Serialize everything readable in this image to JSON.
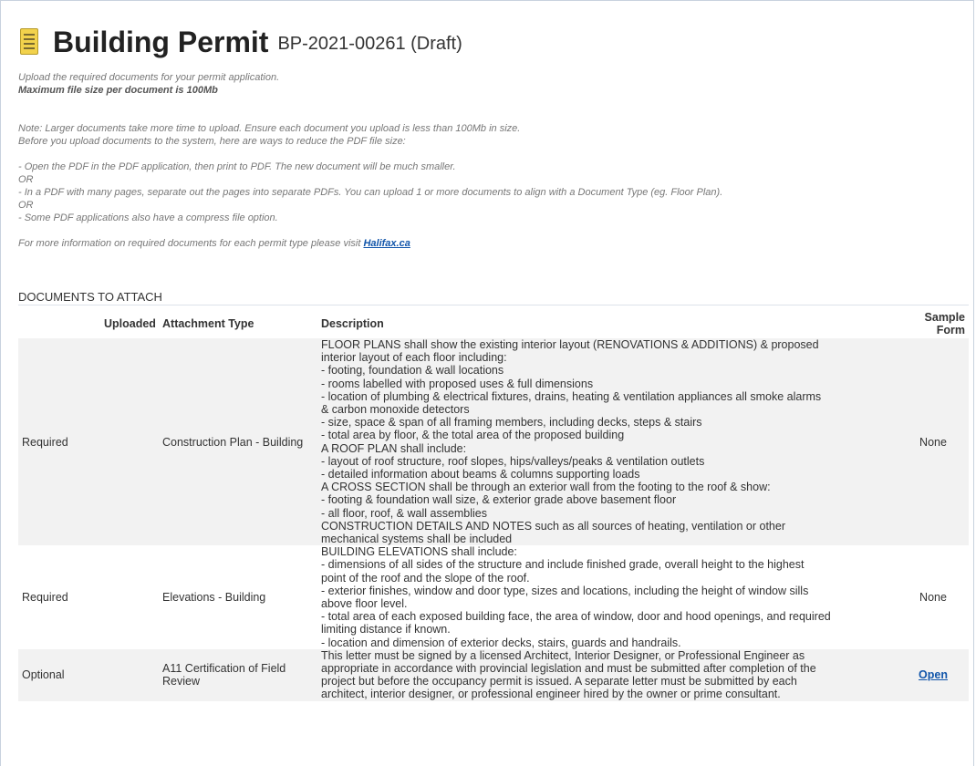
{
  "header": {
    "title": "Building Permit",
    "permit_id": "BP-2021-00261 (Draft)",
    "icon": "document-icon"
  },
  "intro": {
    "line1": "Upload the required documents for your permit application.",
    "line2": "Maximum file size per document is 100Mb",
    "note1": "Note: Larger documents take more time to upload. Ensure each document you upload is less than 100Mb in size.",
    "note2": "Before you upload documents to the system, here are ways to reduce the PDF file size:",
    "tip1": "- Open the PDF in the PDF application, then print to PDF. The new document will be much smaller.",
    "or1": "OR",
    "tip2": "- In a PDF with many pages, separate out the pages into separate PDFs. You can upload 1 or more documents to align with a Document Type (eg. Floor Plan).",
    "or2": "OR",
    "tip3": "- Some PDF applications also have a compress file option.",
    "more_info": "For more information on required documents for each permit type please visit",
    "link_text": "Halifax.ca"
  },
  "documents": {
    "section_title": "DOCUMENTS TO ATTACH",
    "headers": {
      "status": "",
      "uploaded": "Uploaded",
      "attachment_type": "Attachment Type",
      "description": "Description",
      "sample_form": "Sample Form"
    },
    "rows": [
      {
        "status": "Required",
        "uploaded": "",
        "attachment_type": "Construction Plan - Building",
        "description": [
          "FLOOR PLANS shall show the existing interior layout (RENOVATIONS & ADDITIONS) & proposed",
          "interior layout of each floor including:",
          "- footing, foundation & wall locations",
          "- rooms labelled with proposed uses & full dimensions",
          "- location of plumbing & electrical fixtures, drains, heating & ventilation appliances all smoke alarms",
          "& carbon monoxide detectors",
          "- size, space & span of all framing members, including decks, steps & stairs",
          "- total area by floor, & the total area of the proposed building",
          "A ROOF PLAN shall include:",
          "- layout of roof structure, roof slopes, hips/valleys/peaks & ventilation outlets",
          "- detailed information about beams & columns supporting loads",
          "A CROSS SECTION shall be through an exterior wall from the footing to the roof & show:",
          "- footing & foundation wall size, & exterior grade above basement floor",
          "- all floor, roof, & wall assemblies",
          "CONSTRUCTION DETAILS AND NOTES such as all sources of heating, ventilation or other",
          "mechanical systems shall be included"
        ],
        "sample_form": "None"
      },
      {
        "status": "Required",
        "uploaded": "",
        "attachment_type": "Elevations - Building",
        "description": [
          "BUILDING ELEVATIONS shall include:",
          "- dimensions of all sides of the structure and include finished grade, overall height to the highest",
          "point of the roof and the slope of the roof.",
          "- exterior finishes, window and door type, sizes and locations, including the height of window sills",
          "above floor level.",
          "- total area of each exposed building face, the area of window, door and hood openings, and required",
          "limiting distance if known.",
          "- location and dimension of exterior decks, stairs, guards and handrails."
        ],
        "sample_form": "None"
      },
      {
        "status": "Optional",
        "uploaded": "",
        "attachment_type": "A11 Certification of Field Review",
        "description": [
          "This letter must be signed by a licensed Architect, Interior Designer, or Professional Engineer as",
          "appropriate in accordance with provincial legislation and must be submitted after completion of the",
          "project but before the occupancy permit is issued. A separate letter must be submitted by each",
          "architect, interior designer, or professional engineer hired by the owner or prime consultant."
        ],
        "sample_form": "Open"
      }
    ]
  }
}
